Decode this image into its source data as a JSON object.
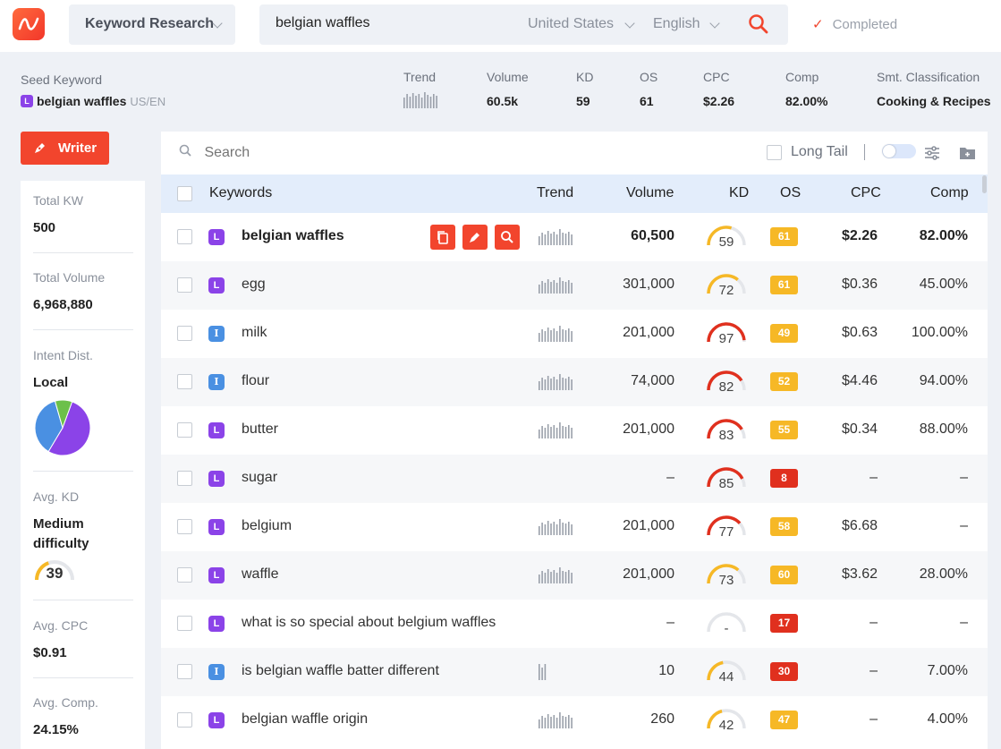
{
  "topbar": {
    "mode": "Keyword Research",
    "query": "belgian waffles",
    "country": "United States",
    "language": "English",
    "status": "Completed"
  },
  "seed": {
    "label": "Seed Keyword",
    "intent": "L",
    "keyword": "belgian waffles",
    "locale": "US/EN",
    "metrics": {
      "trend_label": "Trend",
      "volume_label": "Volume",
      "volume": "60.5k",
      "kd_label": "KD",
      "kd": "59",
      "os_label": "OS",
      "os": "61",
      "cpc_label": "CPC",
      "cpc": "$2.26",
      "comp_label": "Comp",
      "comp": "82.00%",
      "class_label": "Smt. Classification",
      "class": "Cooking & Recipes"
    }
  },
  "writer": {
    "label": "Writer"
  },
  "sidebar": {
    "total_kw_label": "Total KW",
    "total_kw": "500",
    "total_volume_label": "Total Volume",
    "total_volume": "6,968,880",
    "intent_label": "Intent Dist.",
    "intent_value": "Local",
    "intent_pie": [
      {
        "name": "Local",
        "share": 0.53,
        "color": "#8b43e8"
      },
      {
        "name": "Informational",
        "share": 0.37,
        "color": "#4a90e2"
      },
      {
        "name": "Other",
        "share": 0.1,
        "color": "#6cc04a"
      }
    ],
    "avg_kd_label": "Avg. KD",
    "avg_kd_text": "Medium difficulty",
    "avg_kd": "39",
    "avg_cpc_label": "Avg. CPC",
    "avg_cpc": "$0.91",
    "avg_comp_label": "Avg. Comp.",
    "avg_comp": "24.15%"
  },
  "table": {
    "search_placeholder": "Search",
    "long_tail_label": "Long Tail",
    "headers": {
      "keywords": "Keywords",
      "trend": "Trend",
      "volume": "Volume",
      "kd": "KD",
      "os": "OS",
      "cpc": "CPC",
      "comp": "Comp"
    },
    "rows": [
      {
        "keyword": "belgian waffles",
        "intent": "L",
        "trend": true,
        "volume": "60,500",
        "kd": "59",
        "os": "61",
        "cpc": "$2.26",
        "comp": "82.00%",
        "bold": true,
        "actions": true
      },
      {
        "keyword": "egg",
        "intent": "L",
        "trend": true,
        "volume": "301,000",
        "kd": "72",
        "os": "61",
        "cpc": "$0.36",
        "comp": "45.00%"
      },
      {
        "keyword": "milk",
        "intent": "I",
        "trend": true,
        "volume": "201,000",
        "kd": "97",
        "os": "49",
        "cpc": "$0.63",
        "comp": "100.00%"
      },
      {
        "keyword": "flour",
        "intent": "I",
        "trend": true,
        "volume": "74,000",
        "kd": "82",
        "os": "52",
        "cpc": "$4.46",
        "comp": "94.00%"
      },
      {
        "keyword": "butter",
        "intent": "L",
        "trend": true,
        "volume": "201,000",
        "kd": "83",
        "os": "55",
        "cpc": "$0.34",
        "comp": "88.00%"
      },
      {
        "keyword": "sugar",
        "intent": "L",
        "trend": false,
        "volume": "–",
        "kd": "85",
        "os": "8",
        "cpc": "–",
        "comp": "–"
      },
      {
        "keyword": "belgium",
        "intent": "L",
        "trend": true,
        "volume": "201,000",
        "kd": "77",
        "os": "58",
        "cpc": "$6.68",
        "comp": "–"
      },
      {
        "keyword": "waffle",
        "intent": "L",
        "trend": true,
        "volume": "201,000",
        "kd": "73",
        "os": "60",
        "cpc": "$3.62",
        "comp": "28.00%"
      },
      {
        "keyword": "what is so special about belgium waffles",
        "intent": "L",
        "trend": false,
        "volume": "–",
        "kd": "-",
        "os": "17",
        "cpc": "–",
        "comp": "–"
      },
      {
        "keyword": "is belgian waffle batter different",
        "intent": "I",
        "trend": "short",
        "volume": "10",
        "kd": "44",
        "os": "30",
        "cpc": "–",
        "comp": "7.00%"
      },
      {
        "keyword": "belgian waffle origin",
        "intent": "L",
        "trend": true,
        "volume": "260",
        "kd": "42",
        "os": "47",
        "cpc": "–",
        "comp": "4.00%"
      }
    ]
  },
  "colors": {
    "accent": "#f2452d",
    "os_high": "#f6b826",
    "os_low": "#e0301e",
    "kd_medium": "#f6b826",
    "kd_hard": "#e0301e",
    "intent_local": "#8b43e8",
    "intent_info": "#4a90e2"
  },
  "icons": [
    "logo-icon",
    "chevron-down-icon",
    "search-icon",
    "check-icon",
    "pen-icon",
    "copy-icon",
    "settings-sliders-icon",
    "folder-add-icon"
  ]
}
